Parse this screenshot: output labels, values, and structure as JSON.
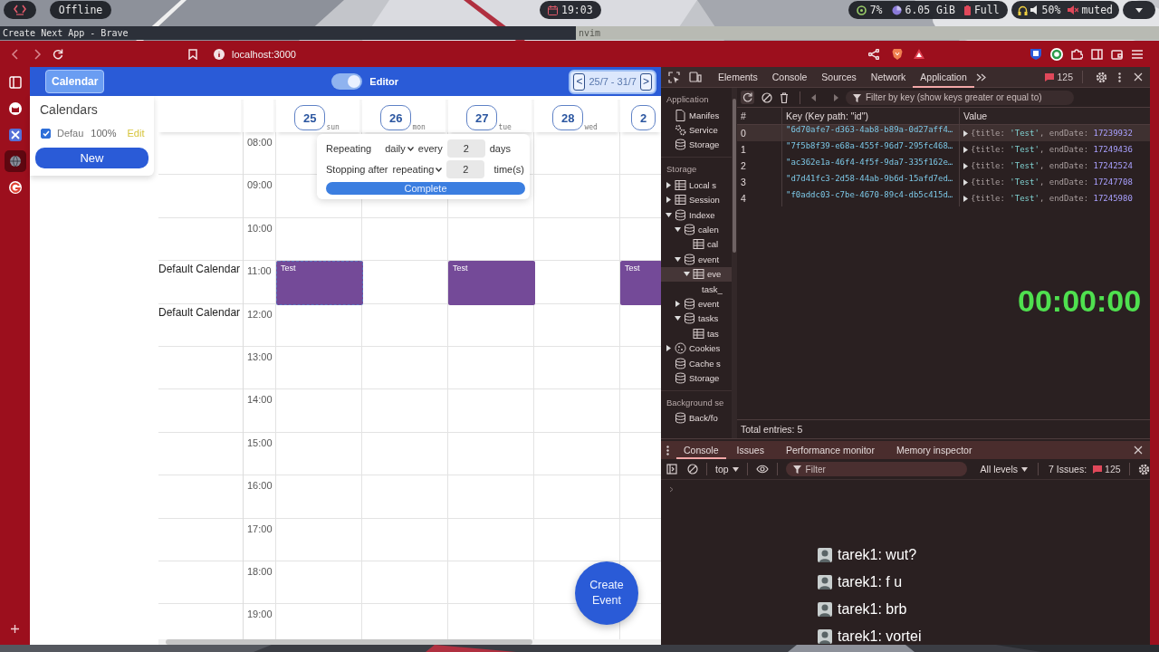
{
  "system_bar": {
    "offline": "Offline",
    "clock": "19:03",
    "cpu": "7%",
    "memory": "6.05 GiB",
    "battery": "Full",
    "volume": "50%",
    "audio": "muted"
  },
  "window": {
    "title": "Create Next App - Brave",
    "other_title": "nvim"
  },
  "browser": {
    "url": "localhost:3000"
  },
  "rail": {
    "items": [
      {
        "kind": "panel",
        "selected": false
      },
      {
        "kind": "cat",
        "selected": false
      },
      {
        "kind": "tools",
        "selected": false
      },
      {
        "kind": "globe",
        "selected": true
      },
      {
        "kind": "ring",
        "selected": false
      }
    ]
  },
  "app": {
    "brand_button": "Calendar",
    "editor_toggle": {
      "label": "Editor",
      "on": true
    },
    "range": {
      "prev": "<",
      "label": "25/7 - 31/7",
      "next": ">"
    },
    "calendars_title": "Calendars",
    "calendars": [
      {
        "name": "Defau",
        "checked": true,
        "opacity": "100%",
        "edit": "Edit"
      }
    ],
    "new_button": "New",
    "days": [
      {
        "date": "25",
        "weekday": "sun"
      },
      {
        "date": "26",
        "weekday": "mon"
      },
      {
        "date": "27",
        "weekday": "tue"
      },
      {
        "date": "28",
        "weekday": "wed"
      },
      {
        "date": "2"
      }
    ],
    "hours": [
      {
        "time": "08:00"
      },
      {
        "time": "09:00"
      },
      {
        "time": "10:00"
      },
      {
        "time": "11:00",
        "calendar": "Default Calendar",
        "events": [
          {
            "kind": "event",
            "title": "Test",
            "selected": true
          },
          {
            "kind": "empty"
          },
          {
            "kind": "event",
            "title": "Test",
            "selected": false
          },
          {
            "kind": "empty"
          },
          {
            "kind": "event",
            "title": "Test",
            "selected": false
          }
        ]
      },
      {
        "time": "12:00",
        "calendar": "Default Calendar"
      },
      {
        "time": "13:00"
      },
      {
        "time": "14:00"
      },
      {
        "time": "15:00"
      },
      {
        "time": "16:00"
      },
      {
        "time": "17:00"
      },
      {
        "time": "18:00"
      },
      {
        "time": "19:00"
      }
    ],
    "repeat_popover": {
      "repeat_label": "Repeating",
      "frequency": "daily",
      "every_label": "every",
      "interval": "2",
      "unit": "days",
      "stop_label": "Stopping after",
      "stop_mode": "repeating",
      "count": "2",
      "count_unit": "time(s)",
      "complete": "Complete"
    },
    "fab": "Create Event"
  },
  "devtools": {
    "tabs": [
      {
        "label": "Elements",
        "selected": false
      },
      {
        "label": "Console",
        "selected": false
      },
      {
        "label": "Sources",
        "selected": false
      },
      {
        "label": "Network",
        "selected": false
      },
      {
        "label": "Application",
        "selected": true
      }
    ],
    "issues_badge": "125",
    "sidebar": [
      {
        "title": "Application",
        "items": [
          {
            "label": "Manifes",
            "kind": "file",
            "selected": false
          },
          {
            "label": "Service",
            "kind": "gears",
            "selected": false
          },
          {
            "label": "Storage",
            "kind": "db",
            "selected": false
          }
        ]
      },
      {
        "title": "Storage",
        "items": [
          {
            "label": "Local s",
            "kind": "table",
            "expanded": false,
            "selected": false
          },
          {
            "label": "Session",
            "kind": "table",
            "expanded": false,
            "selected": false
          },
          {
            "label": "Indexe",
            "kind": "db",
            "expanded": true,
            "selected": false,
            "children": [
              {
                "label": "calen",
                "kind": "db",
                "expanded": true,
                "selected": false,
                "children": [
                  {
                    "label": "cal",
                    "kind": "table",
                    "selected": false
                  }
                ]
              },
              {
                "label": "event",
                "kind": "db",
                "expanded": true,
                "selected": false,
                "children": [
                  {
                    "label": "eve",
                    "kind": "table",
                    "expanded": true,
                    "selected": true,
                    "children": [
                      {
                        "label": "task_",
                        "selected": false
                      }
                    ]
                  }
                ]
              },
              {
                "label": "event",
                "kind": "db",
                "expanded": false,
                "selected": false
              },
              {
                "label": "tasks",
                "kind": "db",
                "expanded": true,
                "selected": false,
                "children": [
                  {
                    "label": "tas",
                    "kind": "table",
                    "selected": false
                  }
                ]
              }
            ]
          },
          {
            "label": "Cookies",
            "kind": "cookie",
            "expanded": false,
            "selected": false
          },
          {
            "label": "Cache s",
            "kind": "db",
            "selected": false
          },
          {
            "label": "Storage",
            "kind": "db",
            "selected": false
          }
        ]
      },
      {
        "title": "Background se",
        "items": [
          {
            "label": "Back/fo",
            "kind": "db",
            "selected": false
          }
        ]
      }
    ],
    "filter_placeholder": "Filter by key (show keys greater or equal to)",
    "table": {
      "columns": [
        "#",
        "Key (Key path: \"id\")",
        "Value"
      ],
      "rows": [
        {
          "index": "0",
          "key": "\"6d70afe7-d363-4ab8-b89a-0d27aff4…",
          "value": [
            "{title: ",
            "'Test'",
            ", endDate: ",
            "17239932"
          ],
          "selected": true
        },
        {
          "index": "1",
          "key": "\"7f5b8f39-e68a-455f-96d7-295fc468…",
          "value": [
            "{title: ",
            "'Test'",
            ", endDate: ",
            "17249436"
          ],
          "selected": false
        },
        {
          "index": "2",
          "key": "\"ac362e1a-46f4-4f5f-9da7-335f162e…",
          "value": [
            "{title: ",
            "'Test'",
            ", endDate: ",
            "17242524"
          ],
          "selected": false
        },
        {
          "index": "3",
          "key": "\"d7d41fc3-2d58-44ab-9b6d-15afd7ed…",
          "value": [
            "{title: ",
            "'Test'",
            ", endDate: ",
            "17247708"
          ],
          "selected": false
        },
        {
          "index": "4",
          "key": "\"f0addc03-c7be-4670-89c4-db5c415d…",
          "value": [
            "{title: ",
            "'Test'",
            ", endDate: ",
            "17245980"
          ],
          "selected": false
        }
      ]
    },
    "total": "Total entries: 5",
    "drawer": {
      "tabs": [
        {
          "label": "Console",
          "selected": true
        },
        {
          "label": "Issues",
          "selected": false
        },
        {
          "label": "Performance monitor",
          "selected": false
        },
        {
          "label": "Memory inspector",
          "selected": false
        }
      ],
      "context": "top",
      "filter_placeholder": "Filter",
      "levels": "All levels",
      "issues_label": "7 Issues:",
      "issues_badge": "125"
    }
  },
  "overlay": {
    "timer": "00:00:00",
    "chat": [
      {
        "message": "tarek1: wut?"
      },
      {
        "message": "tarek1: f u"
      },
      {
        "message": "tarek1: brb"
      },
      {
        "message": "tarek1: vortei"
      }
    ]
  }
}
